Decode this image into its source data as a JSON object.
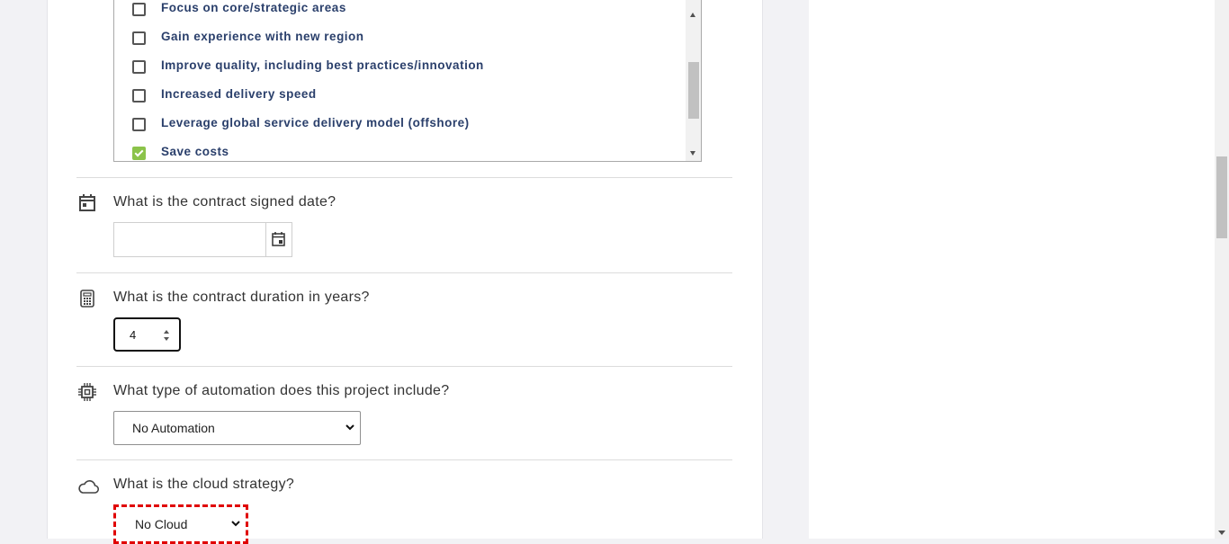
{
  "objectives": {
    "items": [
      {
        "label": "Focus on core/strategic areas",
        "checked": false
      },
      {
        "label": "Gain experience with new region",
        "checked": false
      },
      {
        "label": "Improve quality, including best practices/innovation",
        "checked": false
      },
      {
        "label": "Increased delivery speed",
        "checked": false
      },
      {
        "label": "Leverage global service delivery model (offshore)",
        "checked": false
      },
      {
        "label": "Save costs",
        "checked": true
      }
    ]
  },
  "questions": {
    "signed_date": {
      "label": "What is the contract signed date?",
      "value": "",
      "icon": "calendar-icon"
    },
    "duration": {
      "label": "What is the contract duration in years?",
      "value": "4",
      "icon": "calculator-icon"
    },
    "automation": {
      "label": "What type of automation does this project include?",
      "selected": "No Automation",
      "icon": "chip-icon"
    },
    "cloud": {
      "label": "What is the cloud strategy?",
      "selected": "No Cloud",
      "icon": "cloud-icon"
    }
  },
  "colors": {
    "checked": "#8bc34a",
    "label_text": "#2a3f6b",
    "highlight": "#e00000"
  }
}
